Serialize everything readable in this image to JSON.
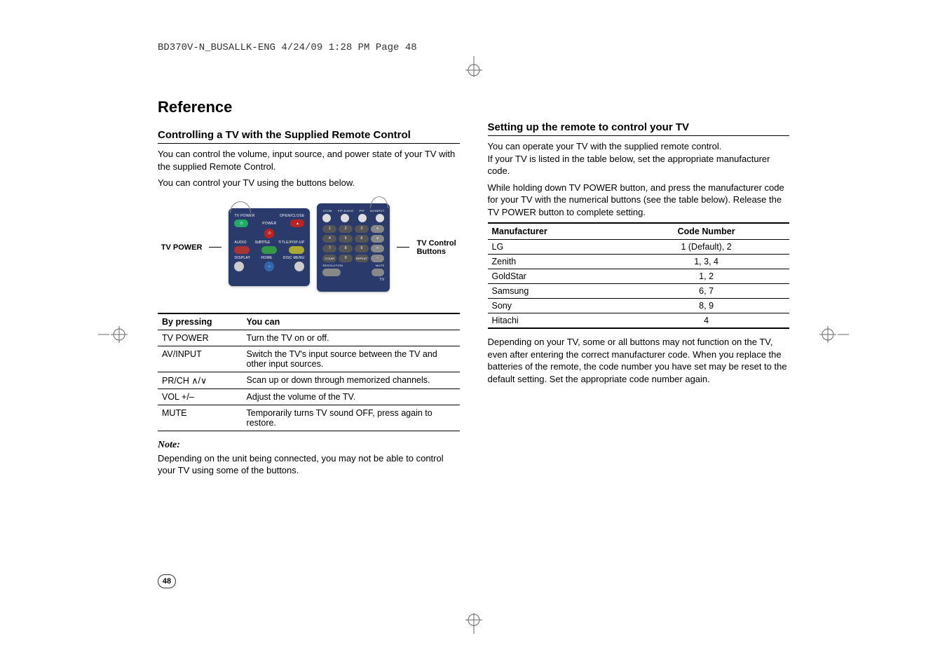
{
  "header_info": "BD370V-N_BUSALLK-ENG  4/24/09  1:28 PM  Page 48",
  "page_number": "48",
  "left": {
    "title": "Reference",
    "section_heading": "Controlling a TV with the Supplied Remote Control",
    "intro_1": "You can control the volume, input source, and power state of your TV with the supplied Remote Control.",
    "intro_2": "You can control your TV using the buttons below.",
    "diagram": {
      "label_left": "TV POWER",
      "label_right_1": "TV Control",
      "label_right_2": "Buttons",
      "remote1_labels": [
        "TV POWER",
        "OPEN/CLOSE",
        "POWER",
        "AUDIO",
        "SUBTITLE",
        "TITLE/POP-UP",
        "DISPLAY",
        "HOME",
        "DISC MENU"
      ],
      "remote2_labels": [
        "ZOOM",
        "PIP AUDIO",
        "PIP",
        "AV/INPUT",
        "1",
        "2",
        "3",
        "4",
        "5",
        "6",
        "7",
        "8",
        "9",
        "CLEAR",
        "0",
        "REPEAT",
        "PR/CH",
        "VOL",
        "MUTE",
        "RESOLUTION",
        "TV"
      ]
    },
    "func_table": {
      "headers": [
        "By pressing",
        "You can"
      ],
      "rows": [
        [
          "TV POWER",
          "Turn the TV on or off."
        ],
        [
          "AV/INPUT",
          "Switch the TV's input source between the TV and other input sources."
        ],
        [
          "PR/CH ∧/∨",
          "Scan up or down through memorized channels."
        ],
        [
          "VOL +/–",
          "Adjust the volume of the TV."
        ],
        [
          "MUTE",
          "Temporarily turns TV sound OFF, press again to restore."
        ]
      ]
    },
    "note_label": "Note:",
    "note_text": "Depending on the unit being connected, you may not be able to control your TV using some of the buttons."
  },
  "right": {
    "section_heading": "Setting up the remote to control your TV",
    "p1": "You can operate your TV with the supplied remote control.",
    "p2": "If your TV is listed in the table below, set the appropriate manufacturer code.",
    "p3": "While holding down TV POWER button, and press the manufacturer code for your TV with the numerical buttons (see the table below). Release the TV POWER button to complete setting.",
    "code_table": {
      "headers": [
        "Manufacturer",
        "Code Number"
      ],
      "rows": [
        [
          "LG",
          "1 (Default), 2"
        ],
        [
          "Zenith",
          "1, 3, 4"
        ],
        [
          "GoldStar",
          "1, 2"
        ],
        [
          "Samsung",
          "6, 7"
        ],
        [
          "Sony",
          "8, 9"
        ],
        [
          "Hitachi",
          "4"
        ]
      ]
    },
    "p4": "Depending on your TV, some or all buttons may not function on the TV, even after entering the correct manufacturer code. When you replace the batteries of the remote, the code number you have set may be reset to the default setting. Set the appropriate code number again."
  }
}
